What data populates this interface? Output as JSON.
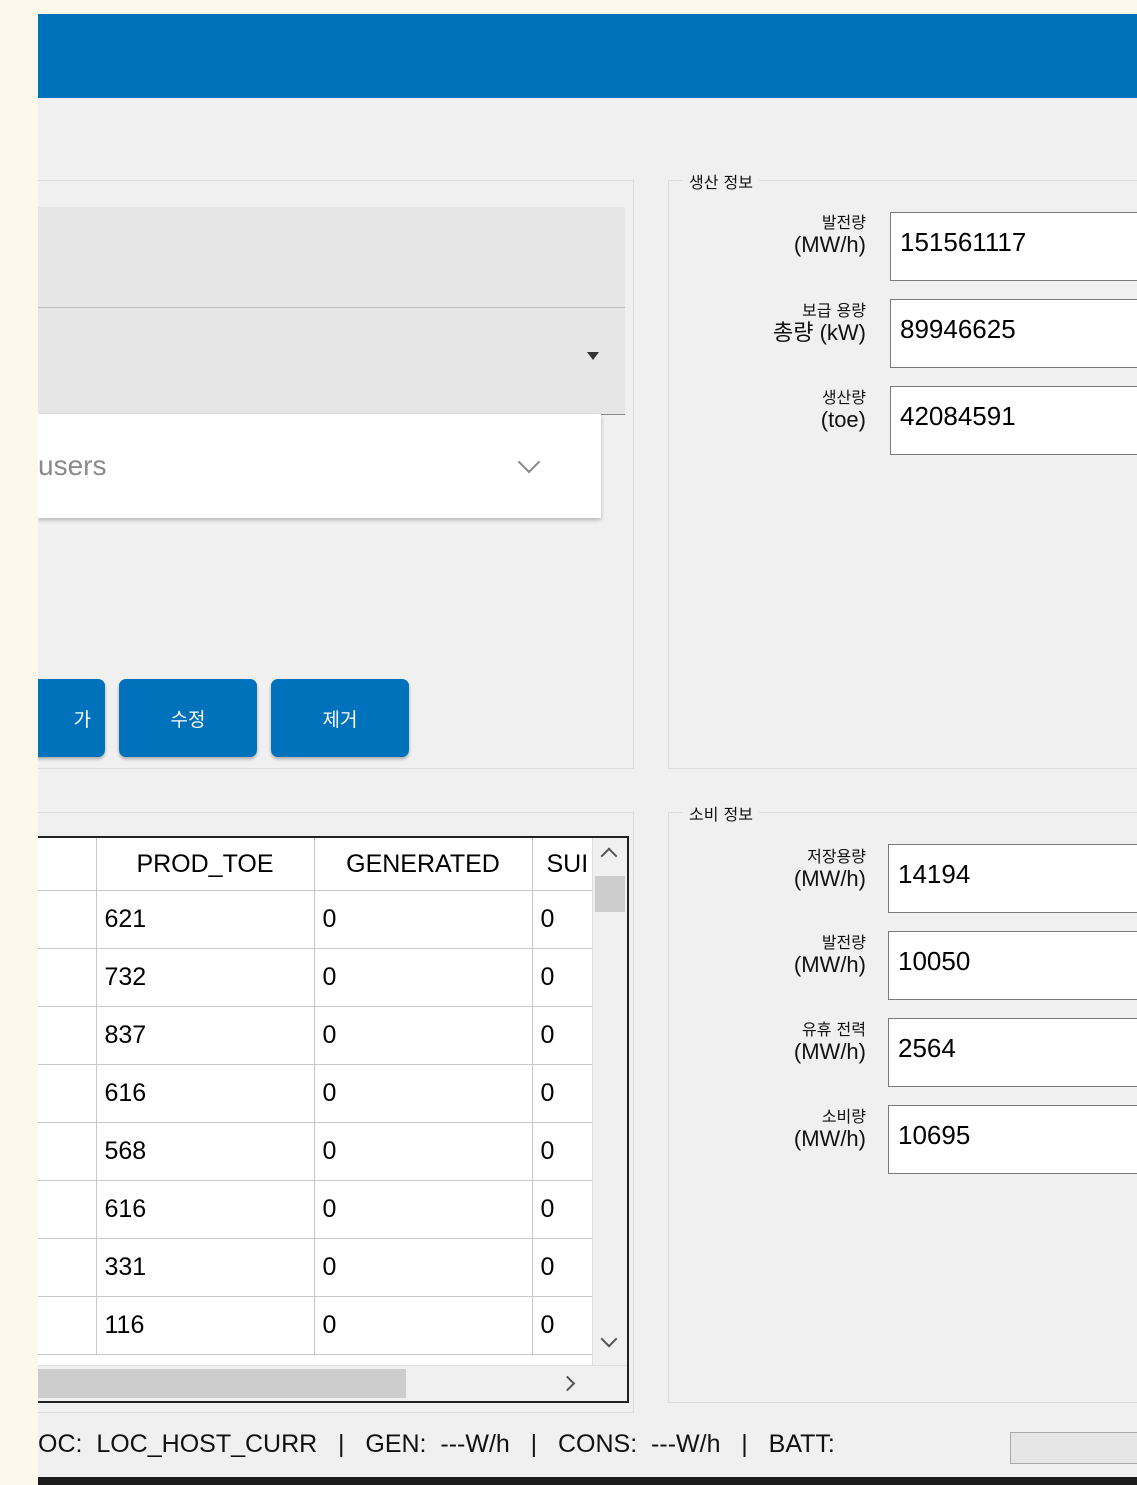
{
  "production": {
    "title": "생산 정보",
    "fields": [
      {
        "label_line1": "발전량",
        "label_line2": "(MW/h)",
        "value": "151561117"
      },
      {
        "label_line1": "보급 용량",
        "label_line2": "총량 (kW)",
        "value": "89946625"
      },
      {
        "label_line1": "생산량",
        "label_line2": "(toe)",
        "value": "42084591"
      }
    ]
  },
  "consumption": {
    "title": "소비 정보",
    "fields": [
      {
        "label_line1": "저장용량",
        "label_line2": "(MW/h)",
        "value": "14194"
      },
      {
        "label_line1": "발전량",
        "label_line2": "(MW/h)",
        "value": "10050"
      },
      {
        "label_line1": "유휴 전력",
        "label_line2": "(MW/h)",
        "value": "2564"
      },
      {
        "label_line1": "소비량",
        "label_line2": "(MW/h)",
        "value": "10695"
      }
    ]
  },
  "filter": {
    "users_dropdown_text": "users"
  },
  "buttons": {
    "add": "가",
    "edit": "수정",
    "delete": "제거"
  },
  "table": {
    "columns": [
      "PROD_TOE",
      "GENERATED",
      "SUI"
    ],
    "rows": [
      [
        "621",
        "0",
        "0"
      ],
      [
        "732",
        "0",
        "0"
      ],
      [
        "837",
        "0",
        "0"
      ],
      [
        "616",
        "0",
        "0"
      ],
      [
        "568",
        "0",
        "0"
      ],
      [
        "616",
        "0",
        "0"
      ],
      [
        "331",
        "0",
        "0"
      ],
      [
        "116",
        "0",
        "0"
      ]
    ]
  },
  "statusbar": {
    "text": "OC:  LOC_HOST_CURR   |   GEN:  ---W/h   |   CONS:  ---W/h   |   BATT:"
  },
  "colors": {
    "accent": "#0072bc",
    "window_bg": "#f0f0f0",
    "outer_bg": "#fdf8ec"
  }
}
